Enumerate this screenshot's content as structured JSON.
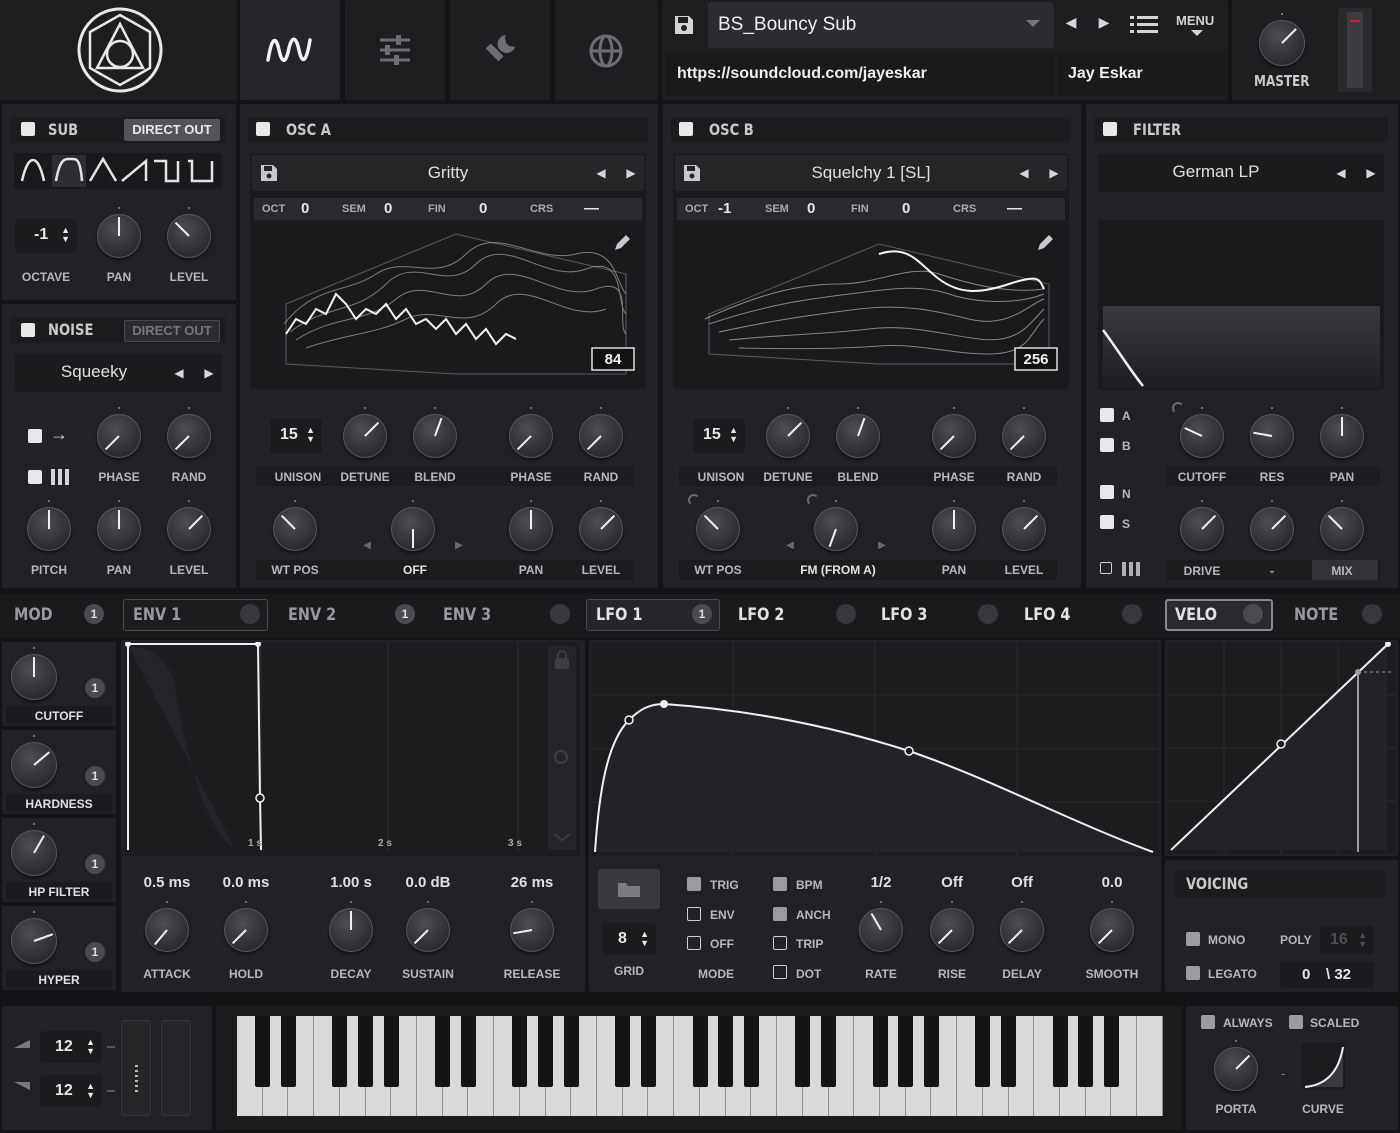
{
  "top": {
    "preset_name": "BS_Bouncy Sub",
    "url": "https://soundcloud.com/jayeskar",
    "author": "Jay Eskar",
    "menu_label": "MENU",
    "master_label": "MASTER",
    "nav_icons": [
      "wave-icon",
      "sliders-icon",
      "wrench-icon",
      "globe-icon"
    ]
  },
  "sub": {
    "title": "SUB",
    "direct_out": "DIRECT OUT",
    "octave": "-1",
    "labels": [
      "OCTAVE",
      "PAN",
      "LEVEL"
    ]
  },
  "noise": {
    "title": "NOISE",
    "direct_out": "DIRECT OUT",
    "preset": "Squeeky",
    "labels_row1": [
      "PHASE",
      "RAND"
    ],
    "labels_row2": [
      "PITCH",
      "PAN",
      "LEVEL"
    ]
  },
  "osc_a": {
    "title": "OSC A",
    "preset": "Gritty",
    "oct_label": "OCT",
    "oct": "0",
    "sem_label": "SEM",
    "sem": "0",
    "fin_label": "FIN",
    "fin": "0",
    "crs_label": "CRS",
    "crs": "—",
    "frame": "84",
    "unison": "15",
    "labels_row1": [
      "UNISON",
      "DETUNE",
      "BLEND",
      "PHASE",
      "RAND"
    ],
    "labels_row2": [
      "WT POS",
      "OFF",
      "PAN",
      "LEVEL"
    ]
  },
  "osc_b": {
    "title": "OSC B",
    "preset": "Squelchy 1 [SL]",
    "oct_label": "OCT",
    "oct": "-1",
    "sem_label": "SEM",
    "sem": "0",
    "fin_label": "FIN",
    "fin": "0",
    "crs_label": "CRS",
    "crs": "—",
    "frame": "256",
    "unison": "15",
    "labels_row1": [
      "UNISON",
      "DETUNE",
      "BLEND",
      "PHASE",
      "RAND"
    ],
    "labels_row2": [
      "WT POS",
      "FM (FROM A)",
      "PAN",
      "LEVEL"
    ]
  },
  "filter": {
    "title": "FILTER",
    "preset": "German LP",
    "routes": [
      "A",
      "B",
      "N",
      "S"
    ],
    "labels_row1": [
      "CUTOFF",
      "RES",
      "PAN"
    ],
    "labels_row2": [
      "DRIVE",
      "-",
      "MIX"
    ]
  },
  "mod_tabs": {
    "mod": "MOD",
    "mod_count": "1",
    "env1": "ENV 1",
    "env2": "ENV 2",
    "env2_count": "1",
    "env3": "ENV 3",
    "lfo1": "LFO 1",
    "lfo1_count": "1",
    "lfo2": "LFO 2",
    "lfo3": "LFO 3",
    "lfo4": "LFO 4",
    "velo": "VELO",
    "note": "NOTE"
  },
  "macros": [
    {
      "label": "CUTOFF",
      "count": "1"
    },
    {
      "label": "HARDNESS",
      "count": "1"
    },
    {
      "label": "HP FILTER",
      "count": "1"
    },
    {
      "label": "HYPER",
      "count": "1"
    }
  ],
  "env": {
    "time_marks": [
      "1 s",
      "2 s",
      "3 s"
    ],
    "values": [
      "0.5 ms",
      "0.0 ms",
      "1.00 s",
      "0.0 dB",
      "26 ms"
    ],
    "labels": [
      "ATTACK",
      "HOLD",
      "DECAY",
      "SUSTAIN",
      "RELEASE"
    ]
  },
  "lfo": {
    "grid": "8",
    "grid_label": "GRID",
    "mode_options": [
      "TRIG",
      "ENV",
      "OFF"
    ],
    "mode_label": "MODE",
    "flags": [
      "BPM",
      "ANCH",
      "TRIP",
      "DOT"
    ],
    "values": [
      "1/2",
      "Off",
      "Off",
      "0.0"
    ],
    "labels": [
      "RATE",
      "RISE",
      "DELAY",
      "SMOOTH"
    ]
  },
  "voicing": {
    "title": "VOICING",
    "mono": "MONO",
    "legato": "LEGATO",
    "poly_label": "POLY",
    "poly": "16",
    "pitch_bend": "0",
    "pitch_bend_max": "\\ 32"
  },
  "bottom": {
    "bend_up": "12",
    "bend_down": "12",
    "always": "ALWAYS",
    "scaled": "SCALED",
    "porta": "PORTA",
    "curve": "CURVE",
    "dash": "-"
  }
}
